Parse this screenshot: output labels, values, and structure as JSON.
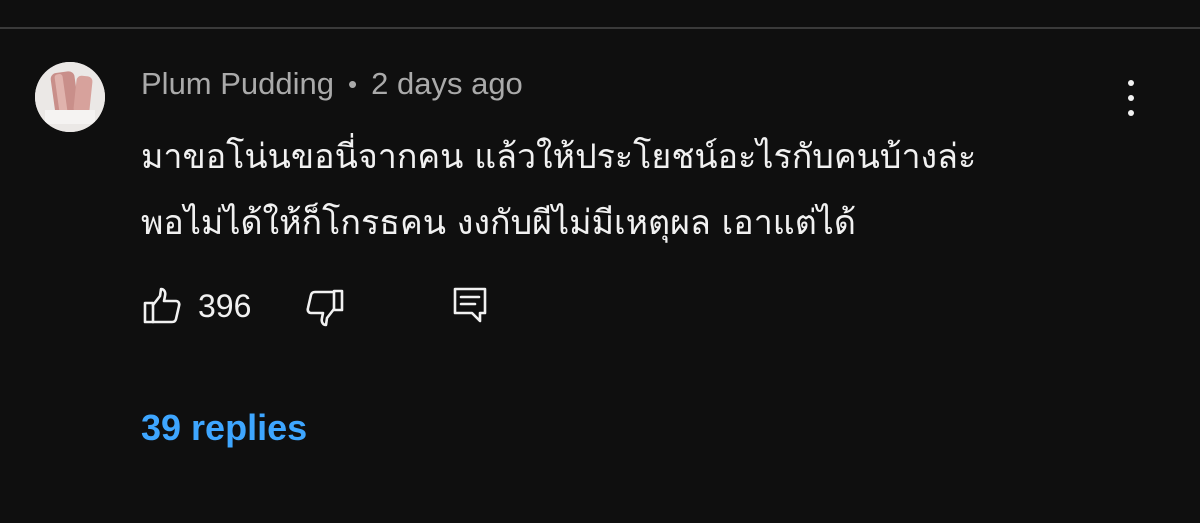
{
  "comment": {
    "author": "Plum Pudding",
    "separator": "•",
    "timestamp": "2 days ago",
    "text_lines": [
      "มาขอโน่นขอนี่จากคน แล้วให้ประโยชน์อะไรกับคนบ้างล่ะ",
      "พอไม่ได้ให้ก็โกรธคน  งงกับผีไม่มีเหตุผล เอาแต่ได้"
    ],
    "like_count": "396",
    "replies_label": "39 replies"
  },
  "icons": {
    "avatar": "avatar-image",
    "more": "more-vert-icon",
    "like": "thumbs-up-icon",
    "dislike": "thumbs-down-icon",
    "reply": "reply-comment-icon"
  },
  "colors": {
    "background": "#0f0f0f",
    "text": "#f1f1f1",
    "secondary_text": "#aaaaaa",
    "link": "#3ea6ff",
    "divider": "#3a3a3a"
  }
}
